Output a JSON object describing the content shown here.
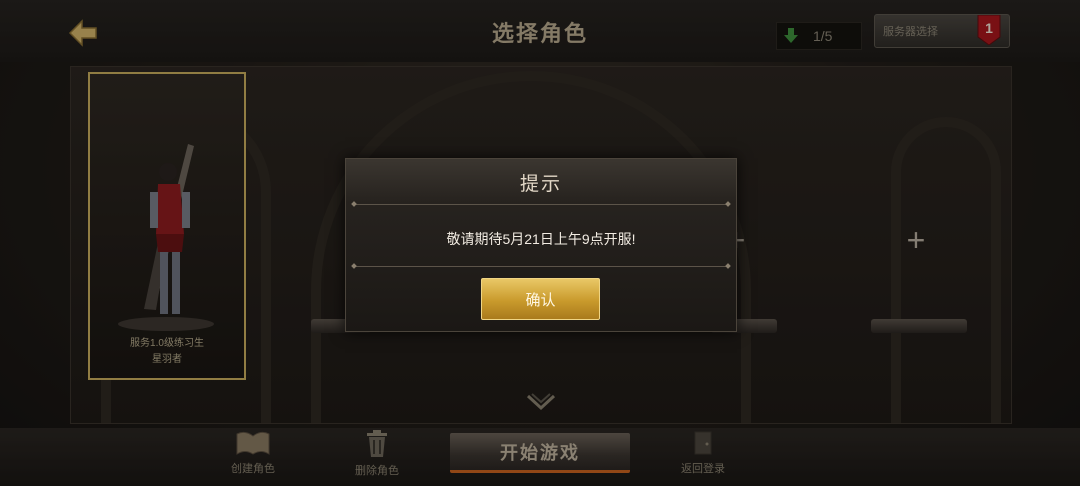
{
  "header": {
    "title": "选择角色",
    "slot_count": "1/5",
    "server_button_label": "服务器选择",
    "server_badge": "1"
  },
  "character": {
    "name_line1": "服务1.0级练习生",
    "name_line2": "星羽者"
  },
  "empty_slots": [
    {
      "label": "+"
    },
    {
      "label": "+"
    }
  ],
  "bottom": {
    "create_label": "创建角色",
    "delete_label": "删除角色",
    "start_label": "开始游戏",
    "right_label": "返回登录"
  },
  "dialog": {
    "title": "提示",
    "message": "敬请期待5月21日上午9点开服!",
    "confirm_label": "确认"
  },
  "colors": {
    "accent_gold": "#c9ad5e",
    "confirm_gold": "#d9ab3e",
    "badge_red": "#a8171c",
    "start_underline": "#c9631f"
  }
}
